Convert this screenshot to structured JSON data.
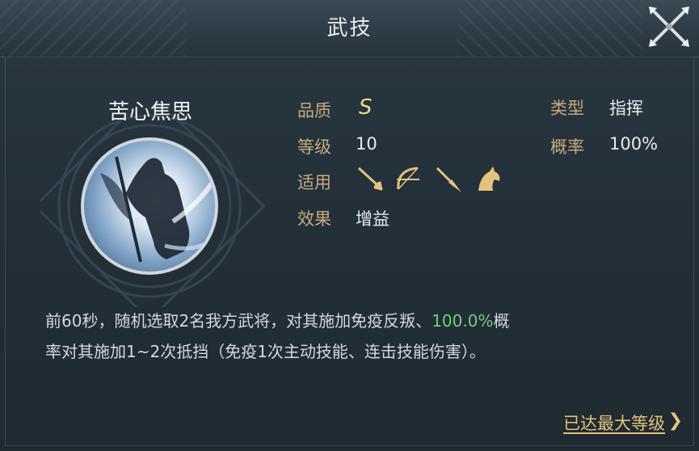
{
  "window": {
    "title": "武技",
    "close_icon": "close-crossed-swords-icon"
  },
  "skill": {
    "name": "苦心焦思",
    "quality_label": "品质",
    "quality_value": "S",
    "level_label": "等级",
    "level_value": "10",
    "applicable_label": "适用",
    "applicable_units": [
      "sword-icon",
      "bow-icon",
      "spear-icon",
      "horse-icon"
    ],
    "effect_label": "效果",
    "effect_value": "增益",
    "type_label": "类型",
    "type_value": "指挥",
    "chance_label": "概率",
    "chance_value": "100%"
  },
  "description": {
    "part1": "前60秒，随机选取2名我方武将，对其施加免疫反叛、",
    "highlight": "100.0%",
    "part2": "概",
    "line2": "率对其施加1~2次抵挡（免疫1次主动技能、连击技能伤害）。"
  },
  "footer": {
    "max_level_label": "已达最大等级",
    "chevron": "❯"
  },
  "colors": {
    "label": "#c7ab7c",
    "value": "#e6ebee",
    "highlight": "#6fd07a",
    "link": "#e3c27a",
    "grade": "#f1d98a"
  }
}
